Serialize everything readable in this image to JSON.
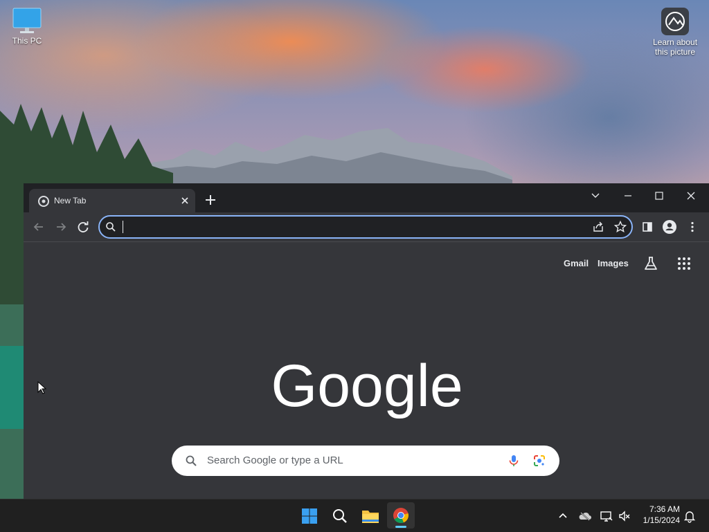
{
  "desktop": {
    "this_pc_label": "This PC",
    "learn_label_line1": "Learn about",
    "learn_label_line2": "this picture"
  },
  "browser": {
    "tab_title": "New Tab",
    "address_value": "",
    "header_links": {
      "gmail": "Gmail",
      "images": "Images"
    },
    "search_placeholder": "Search Google or type a URL",
    "accent_color": "#8ab4f8"
  },
  "taskbar": {
    "apps": [
      "start-icon",
      "search-icon",
      "file-explorer-icon",
      "chrome-icon"
    ],
    "time": "7:36 AM",
    "date": "1/15/2024"
  }
}
